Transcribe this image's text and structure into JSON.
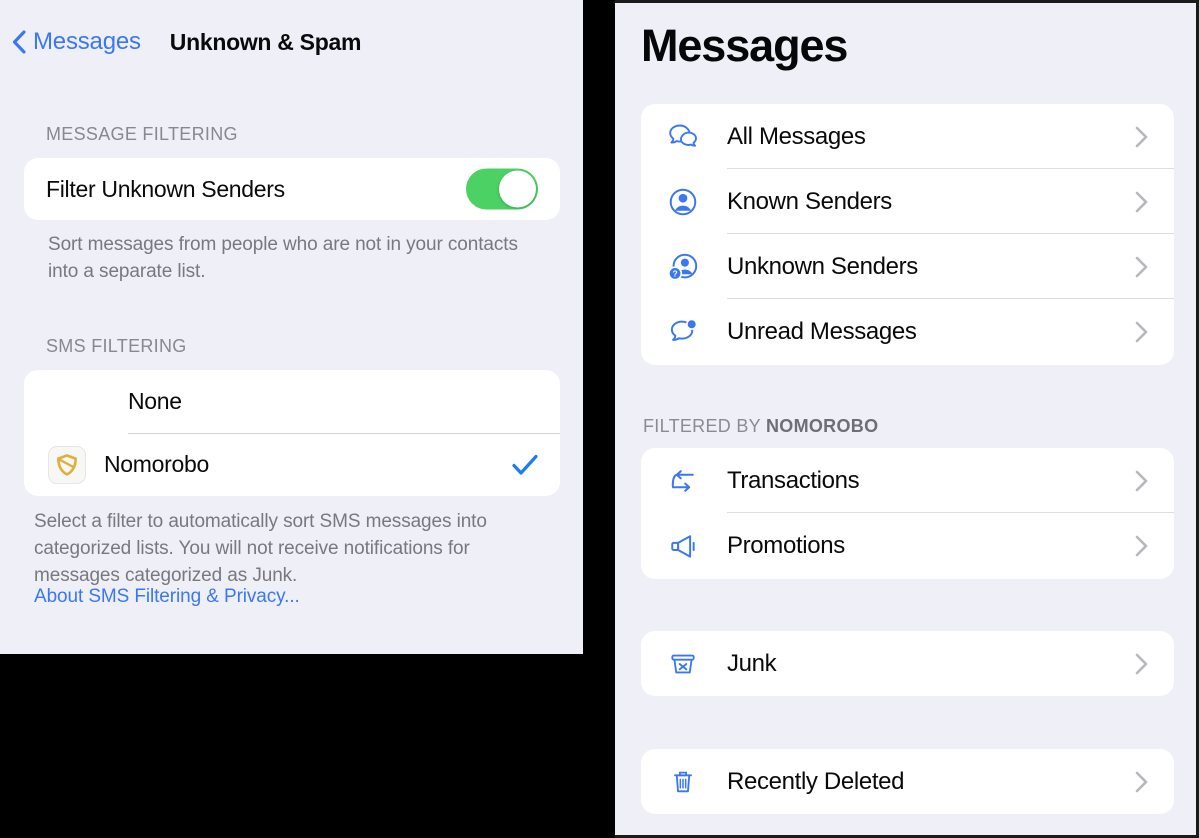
{
  "colors": {
    "accent_blue": "#3B78F0",
    "toggle_green": "#4CD164",
    "icon_blue": "#3B78F0",
    "nomorobo_gold": "#E2AE3C",
    "background": "#EFEFF7",
    "card": "#FFFFFF",
    "secondary_text": "#88888F"
  },
  "left_pane": {
    "nav": {
      "back_label": "Messages",
      "back_icon": "chevron-left-icon",
      "title": "Unknown & Spam"
    },
    "message_filtering": {
      "header": "MESSAGE FILTERING",
      "row": {
        "label": "Filter Unknown Senders",
        "toggle_state": "on",
        "toggle_value": "true"
      },
      "footnote": "Sort messages from people who are not in your contacts into a separate list."
    },
    "sms_filtering": {
      "header": "SMS FILTERING",
      "options": [
        {
          "label": "None",
          "icon": null,
          "selected": false
        },
        {
          "label": "Nomorobo",
          "icon": "nomorobo-shield-icon",
          "selected": true,
          "check_icon": "checkmark-icon"
        }
      ],
      "footnote": "Select a filter to automatically sort SMS messages into categorized lists. You will not receive notifications for messages categorized as Junk.",
      "link": "About SMS Filtering & Privacy..."
    }
  },
  "right_pane": {
    "title": "Messages",
    "groups": [
      {
        "header": null,
        "rows": [
          {
            "label": "All Messages",
            "icon": "two-speech-bubbles-icon",
            "chevron": "chevron-right-icon"
          },
          {
            "label": "Known Senders",
            "icon": "person-circle-icon",
            "chevron": "chevron-right-icon"
          },
          {
            "label": "Unknown Senders",
            "icon": "person-question-mark-icon",
            "chevron": "chevron-right-icon"
          },
          {
            "label": "Unread Messages",
            "icon": "bubble-badge-icon",
            "chevron": "chevron-right-icon"
          }
        ]
      },
      {
        "header_prefix": "FILTERED BY ",
        "header_bold": "NOMOROBO",
        "rows": [
          {
            "label": "Transactions",
            "icon": "arrow-exchange-icon",
            "chevron": "chevron-right-icon"
          },
          {
            "label": "Promotions",
            "icon": "megaphone-icon",
            "chevron": "chevron-right-icon"
          }
        ]
      },
      {
        "header": null,
        "rows": [
          {
            "label": "Junk",
            "icon": "bin-x-icon",
            "chevron": "chevron-right-icon"
          }
        ]
      },
      {
        "header": null,
        "rows": [
          {
            "label": "Recently Deleted",
            "icon": "trash-icon",
            "chevron": "chevron-right-icon"
          }
        ]
      }
    ]
  }
}
